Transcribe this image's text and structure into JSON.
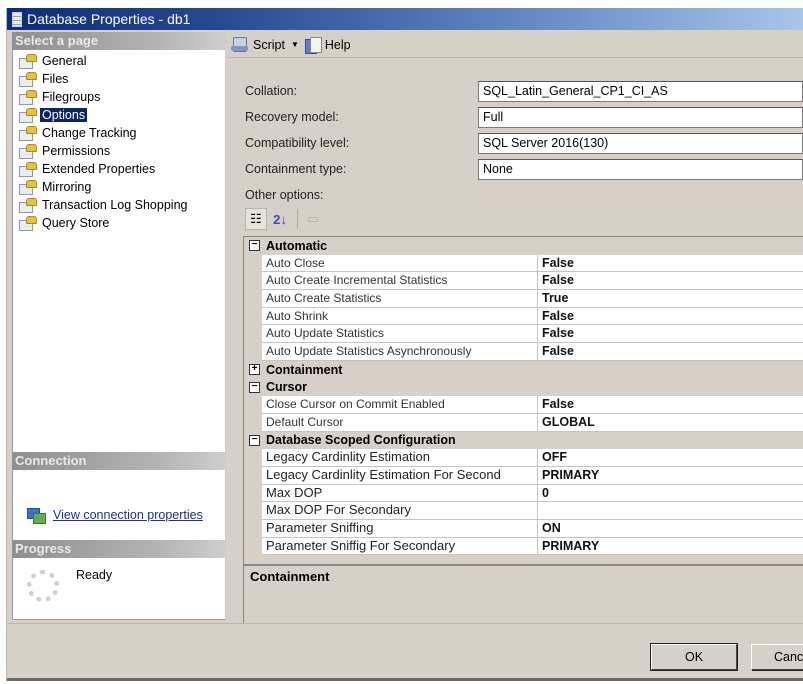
{
  "window": {
    "title": "Database Properties - db1"
  },
  "left": {
    "select_header": "Select a page",
    "pages": [
      {
        "label": "General"
      },
      {
        "label": "Files"
      },
      {
        "label": "Filegroups"
      },
      {
        "label": "Options",
        "selected": true
      },
      {
        "label": "Change Tracking"
      },
      {
        "label": "Permissions"
      },
      {
        "label": "Extended Properties"
      },
      {
        "label": "Mirroring"
      },
      {
        "label": "Transaction Log Shopping"
      },
      {
        "label": "Query Store"
      }
    ],
    "connection_header": "Connection",
    "connection_link": "View connection properties",
    "progress_header": "Progress",
    "progress_status": "Ready"
  },
  "toolbar": {
    "script_label": "Script",
    "help_label": "Help"
  },
  "form": {
    "fields": [
      {
        "label": "Collation:",
        "value": "SQL_Latin_General_CP1_CI_AS"
      },
      {
        "label": "Recovery model:",
        "value": "Full"
      },
      {
        "label": "Compatibility level:",
        "value": "SQL Server 2016(130)"
      },
      {
        "label": "Containment type:",
        "value": "None"
      }
    ],
    "other_options_label": "Other options:"
  },
  "grid": {
    "categories": [
      {
        "name": "Automatic",
        "expanded": true,
        "symbol": "−",
        "props": [
          {
            "name": "Auto Close",
            "value": "False"
          },
          {
            "name": "Auto Create Incremental Statistics",
            "value": "False"
          },
          {
            "name": "Auto Create Statistics",
            "value": "True"
          },
          {
            "name": "Auto Shrink",
            "value": "False"
          },
          {
            "name": "Auto Update Statistics",
            "value": "False"
          },
          {
            "name": "Auto Update Statistics Asynchronously",
            "value": "False"
          }
        ]
      },
      {
        "name": "Containment",
        "expanded": false,
        "symbol": "+",
        "props": []
      },
      {
        "name": "Cursor",
        "expanded": true,
        "symbol": "−",
        "props": [
          {
            "name": "Close Cursor on Commit Enabled",
            "value": "False"
          },
          {
            "name": "Default Cursor",
            "value": "GLOBAL"
          }
        ]
      },
      {
        "name": "Database Scoped Configuration",
        "expanded": true,
        "symbol": "−",
        "props": [
          {
            "name": "Legacy Cardinlity Estimation",
            "value": "OFF"
          },
          {
            "name": "Legacy Cardinlity Estimation For Second",
            "value": "PRIMARY"
          },
          {
            "name": "Max DOP",
            "value": "0"
          },
          {
            "name": "Max DOP For Secondary",
            "value": ""
          },
          {
            "name": "Parameter Sniffing",
            "value": "ON"
          },
          {
            "name": "Parameter Sniffig For Secondary",
            "value": "PRIMARY"
          }
        ]
      }
    ]
  },
  "description": {
    "title": "Containment"
  },
  "footer": {
    "ok_label": "OK",
    "cancel_label": "Cancel"
  }
}
